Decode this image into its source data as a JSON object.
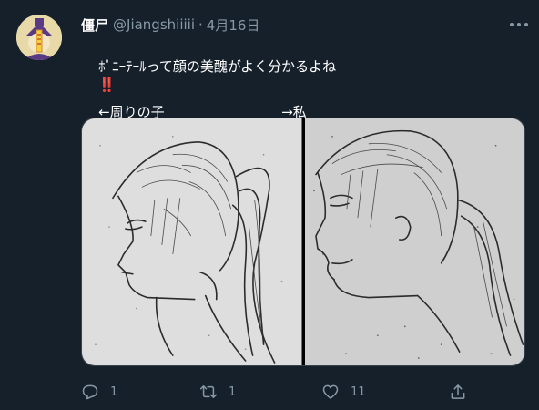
{
  "tweet": {
    "display_name": "僵尸",
    "handle": "@Jiangshiiiii",
    "separator": "·",
    "date": "4月16日",
    "text": "ﾎﾟﾆｰﾃｰﾙって顔の美醜がよく分かるよね",
    "emoji": "‼️",
    "caption_left": "←周りの子",
    "caption_right": "→私",
    "media": [
      {
        "icon": "pencil-sketch-profile-photo"
      },
      {
        "icon": "pencil-sketch-profile-photo"
      }
    ]
  },
  "actions": {
    "reply_count": "1",
    "retweet_count": "1",
    "like_count": "11",
    "icons": [
      "reply-icon",
      "retweet-icon",
      "like-icon",
      "share-icon"
    ]
  },
  "colors": {
    "background": "#15202b",
    "text": "#ffffff",
    "secondary": "#8899a6",
    "border": "#38444d"
  }
}
